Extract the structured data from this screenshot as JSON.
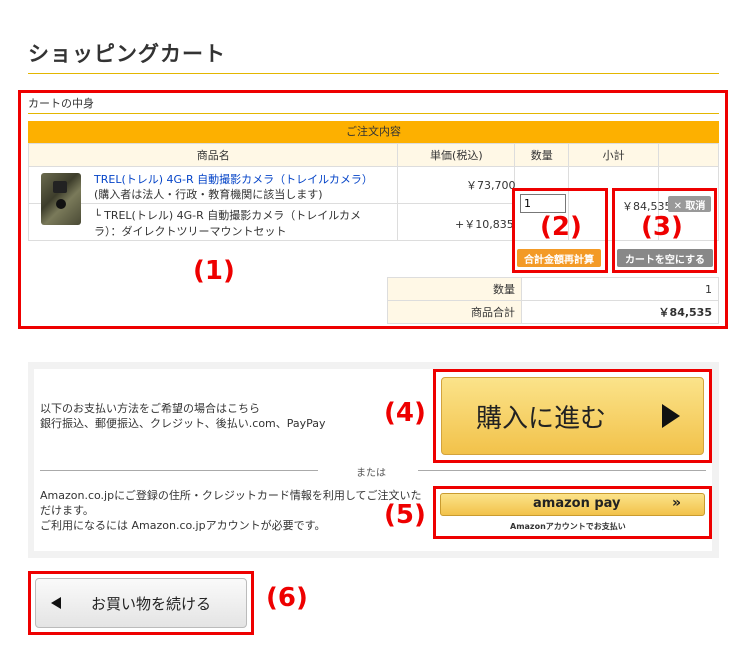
{
  "page": {
    "title": "ショッピングカート"
  },
  "cart": {
    "heading": "カートの中身",
    "order_bar": "ご注文内容",
    "columns": {
      "product": "商品名",
      "unit_price": "単価(税込)",
      "qty": "数量",
      "subtotal": "小計"
    },
    "item": {
      "name": "TREL(トレル) 4G-R 自動撮影カメラ（トレイルカメラ）",
      "note": "(購入者は法人・行政・教育機関に該当します)",
      "price": "￥73,700",
      "option": "└ TREL(トレル) 4G-R 自動撮影カメラ（トレイルカメラ）：ダイレクトツリーマウントセット",
      "option_price": "+￥10,835",
      "quantity": "1",
      "row_total": "￥84,535"
    },
    "buttons": {
      "recalc": "合計金額再計算",
      "cancel": "✕ 取消",
      "empty": "カートを空にする"
    },
    "summary": {
      "qty_label": "数量",
      "qty_value": "1",
      "total_label": "商品合計",
      "total_value": "￥84,535"
    }
  },
  "payment": {
    "standard_text_1": "以下のお支払い方法をご希望の場合はこちら",
    "standard_text_2": "銀行振込、郵便振込、クレジット、後払い.com、PayPay",
    "purchase_label": "購入に進む",
    "or_text": "または",
    "amazon_text_1": "Amazon.co.jpにご登録の住所・クレジットカード情報を利用してご注文いただけます。",
    "amazon_text_2": "ご利用になるには Amazon.co.jpアカウントが必要です。",
    "amazon_logo": "amazon pay",
    "amazon_chevron": "»",
    "amazon_sub": "Amazonアカウントでお支払い"
  },
  "continue": {
    "label": "お買い物を続ける"
  },
  "annotations": {
    "n1": "(1)",
    "n2": "(2)",
    "n3": "(3)",
    "n4": "(4)",
    "n5": "(5)",
    "n6": "(6)"
  }
}
